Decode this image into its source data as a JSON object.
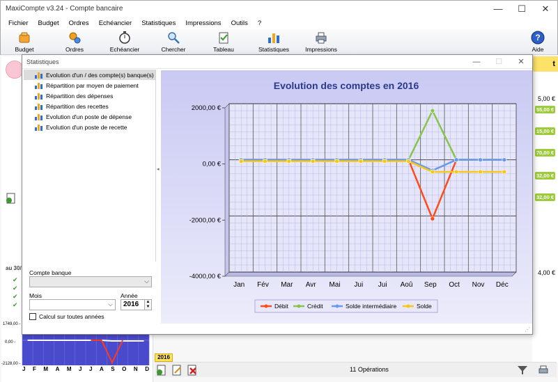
{
  "window": {
    "title": "MaxiCompte v3.24 - Compte bancaire",
    "min": "—",
    "max": "☐",
    "close": "✕"
  },
  "menu": [
    "Fichier",
    "Budget",
    "Ordres",
    "Echéancier",
    "Statistiques",
    "Impressions",
    "Outils",
    "?"
  ],
  "toolbar": {
    "budget": "Budget",
    "ordres": "Ordres",
    "echeancier": "Echéancier",
    "chercher": "Chercher",
    "tableau": "Tableau",
    "statistiques": "Statistiques",
    "impressions": "Impressions",
    "aide": "Aide"
  },
  "background": {
    "summary_title": "au 30/",
    "right_header": "t",
    "right_values": [
      "5,00 €",
      "4,00 €"
    ],
    "green_pills": [
      "55,00 €",
      "15,00 €",
      "70,00 €",
      "32,00 €",
      "32,00 €"
    ],
    "mini_chart": {
      "ytick_labels": [
        "1749,00 -",
        "0,00 -",
        "-2128,00 -"
      ],
      "months": [
        "J",
        "F",
        "M",
        "A",
        "M",
        "J",
        "J",
        "A",
        "S",
        "O",
        "N",
        "D"
      ]
    },
    "year_tab": "2016",
    "operations": "11 Opérations"
  },
  "dialog": {
    "title": "Statistiques",
    "min": "—",
    "max": "☐",
    "close": "✕",
    "stat_items": [
      "Evolution d'un / des compte(s) banque(s)",
      "Répartition par moyen de paiement",
      "Répartition des dépenses",
      "Répartition des recettes",
      "Evolution d'un poste de dépense",
      "Evolution d'un poste de recette"
    ],
    "selected_index": 0,
    "compte_label": "Compte banque",
    "compte_value": "",
    "mois_label": "Mois",
    "mois_value": "",
    "annee_label": "Année",
    "annee_value": "2016",
    "calcul_label": "Calcul sur toutes années",
    "calcul_checked": false
  },
  "chart_data": {
    "type": "line",
    "title": "Evolution des comptes en 2016",
    "categories": [
      "Jan",
      "Fév",
      "Mar",
      "Avr",
      "Mai",
      "Jui",
      "Jui",
      "Aoû",
      "Sep",
      "Oct",
      "Nov",
      "Déc"
    ],
    "ylim": [
      -4000,
      2000
    ],
    "yticks": [
      2000,
      0,
      -2000,
      -4000
    ],
    "ytick_labels": [
      "2000,00 €",
      "0,00 €",
      "-2000,00 €",
      "-4000,00 €"
    ],
    "grid": true,
    "legend_position": "bottom",
    "series": [
      {
        "name": "Débit",
        "color": "#ff4a1c",
        "values": [
          0,
          0,
          0,
          0,
          0,
          0,
          0,
          0,
          -2100,
          0,
          0,
          0
        ]
      },
      {
        "name": "Crédit",
        "color": "#86c44a",
        "values": [
          0,
          0,
          0,
          0,
          0,
          0,
          0,
          0,
          1749,
          0,
          0,
          0
        ]
      },
      {
        "name": "Solde intermédiaire",
        "color": "#6699ee",
        "values": [
          0,
          0,
          0,
          0,
          0,
          0,
          0,
          0,
          -379,
          0,
          0,
          0
        ]
      },
      {
        "name": "Solde",
        "color": "#f6c81c",
        "values": [
          -50,
          -50,
          -50,
          -50,
          -50,
          -50,
          -50,
          -50,
          -429,
          -429,
          -429,
          -429
        ]
      }
    ]
  }
}
